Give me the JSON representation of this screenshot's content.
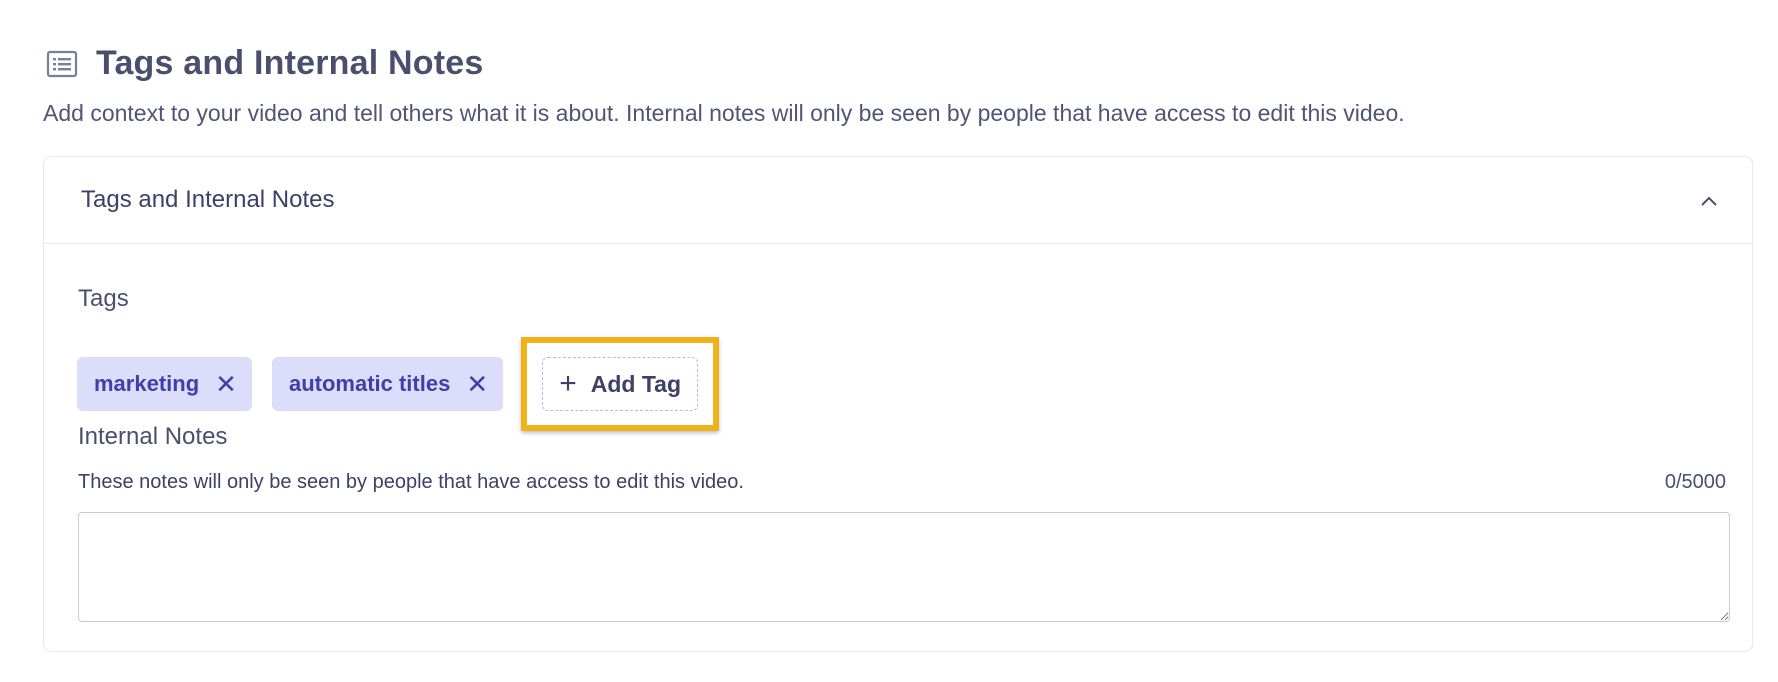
{
  "section": {
    "icon": "list-icon",
    "title": "Tags and Internal Notes",
    "description": "Add context to your video and tell others what it is about. Internal notes will only be seen by people that have access to edit this video."
  },
  "card": {
    "title": "Tags and Internal Notes",
    "collapse_icon": "chevron-up-icon"
  },
  "tags": {
    "label": "Tags",
    "items": [
      {
        "label": "marketing",
        "remove": "✕"
      },
      {
        "label": "automatic titles",
        "remove": "✕"
      }
    ],
    "add_plus": "+",
    "add_label": "Add Tag"
  },
  "notes": {
    "label": "Internal Notes",
    "help": "These notes will only be seen by people that have access to edit this video.",
    "counter": "0/5000",
    "value": ""
  },
  "colors": {
    "tag_bg": "#dcdcfb",
    "tag_text": "#3e3fa8",
    "highlight": "#f0b21a"
  }
}
